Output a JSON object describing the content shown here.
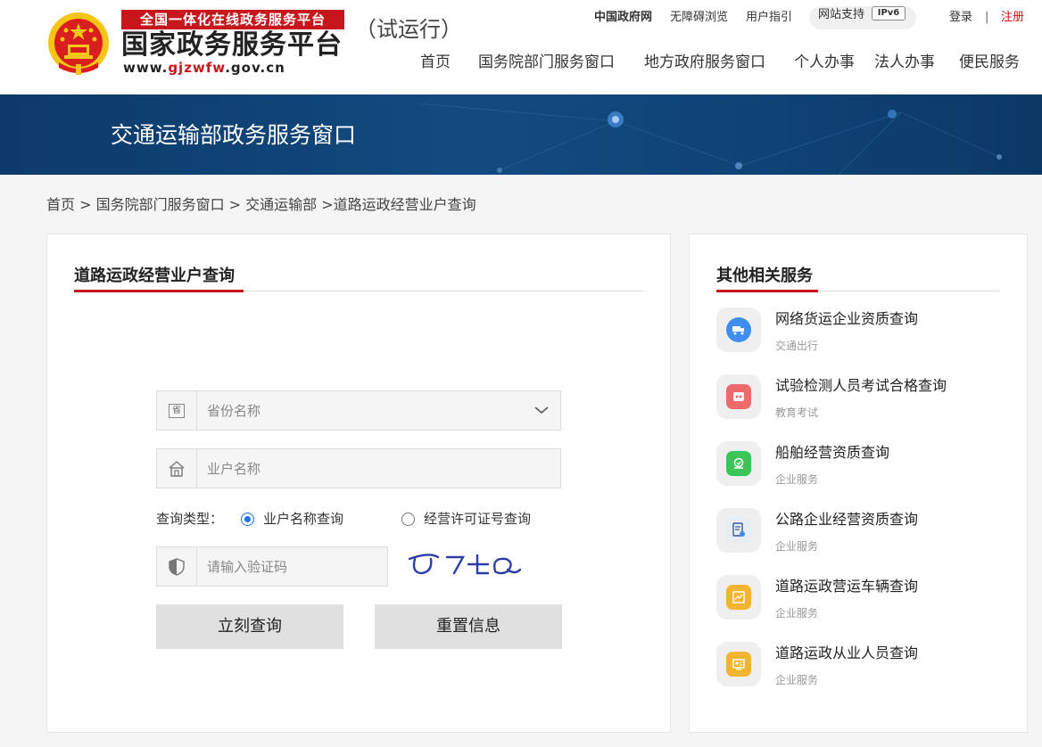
{
  "header": {
    "logo_red_text": "全国一体化在线政务服务平台",
    "logo_main_text": "国家政务服务平台",
    "logo_url_prefix": "www.",
    "logo_url_red": "gjzwfw",
    "logo_url_suffix": ".gov.cn",
    "trial_text": "（试运行）",
    "top_links": {
      "gov": "中国政府网",
      "accessibility": "无障碍浏览",
      "guide": "用户指引",
      "ipv6_label": "网站支持",
      "ipv6_badge": "IPv6",
      "login": "登录",
      "separator": "|",
      "register": "注册"
    },
    "nav": [
      "首页",
      "国务院部门服务窗口",
      "地方政府服务窗口",
      "个人办事",
      "法人办事",
      "便民服务"
    ]
  },
  "banner": {
    "title": "交通运输部政务服务窗口"
  },
  "breadcrumb": "首页 > 国务院部门服务窗口 > 交通运输部 >道路运政经营业户查询",
  "form": {
    "title": "道路运政经营业户查询",
    "province_placeholder": "省份名称",
    "province_icon_char": "省",
    "name_placeholder": "业户名称",
    "query_type_label": "查询类型：",
    "query_type_options": [
      "业户名称查询",
      "经营许可证号查询"
    ],
    "query_type_selected": "业户名称查询",
    "captcha_placeholder": "请输入验证码",
    "submit_label": "立刻查询",
    "reset_label": "重置信息"
  },
  "side": {
    "title": "其他相关服务",
    "items": [
      {
        "name": "网络货运企业资质查询",
        "category": "交通出行",
        "icon": "truck-icon",
        "color": "#3d8ef0"
      },
      {
        "name": "试验检测人员考试合格查询",
        "category": "教育考试",
        "icon": "exam-icon",
        "color": "#ee6a6a"
      },
      {
        "name": "船舶经营资质查询",
        "category": "企业服务",
        "icon": "ship-icon",
        "color": "#3cc35a"
      },
      {
        "name": "公路企业经营资质查询",
        "category": "企业服务",
        "icon": "road-doc-icon",
        "color": "#e8ecf3"
      },
      {
        "name": "道路运政营运车辆查询",
        "category": "企业服务",
        "icon": "vehicle-icon",
        "color": "#f3b431"
      },
      {
        "name": "道路运政从业人员查询",
        "category": "企业服务",
        "icon": "personnel-icon",
        "color": "#f3b431"
      }
    ]
  },
  "colors": {
    "brand_red": "#c8161d",
    "banner_blue": "#124a80",
    "radio_blue": "#1a73e8"
  }
}
